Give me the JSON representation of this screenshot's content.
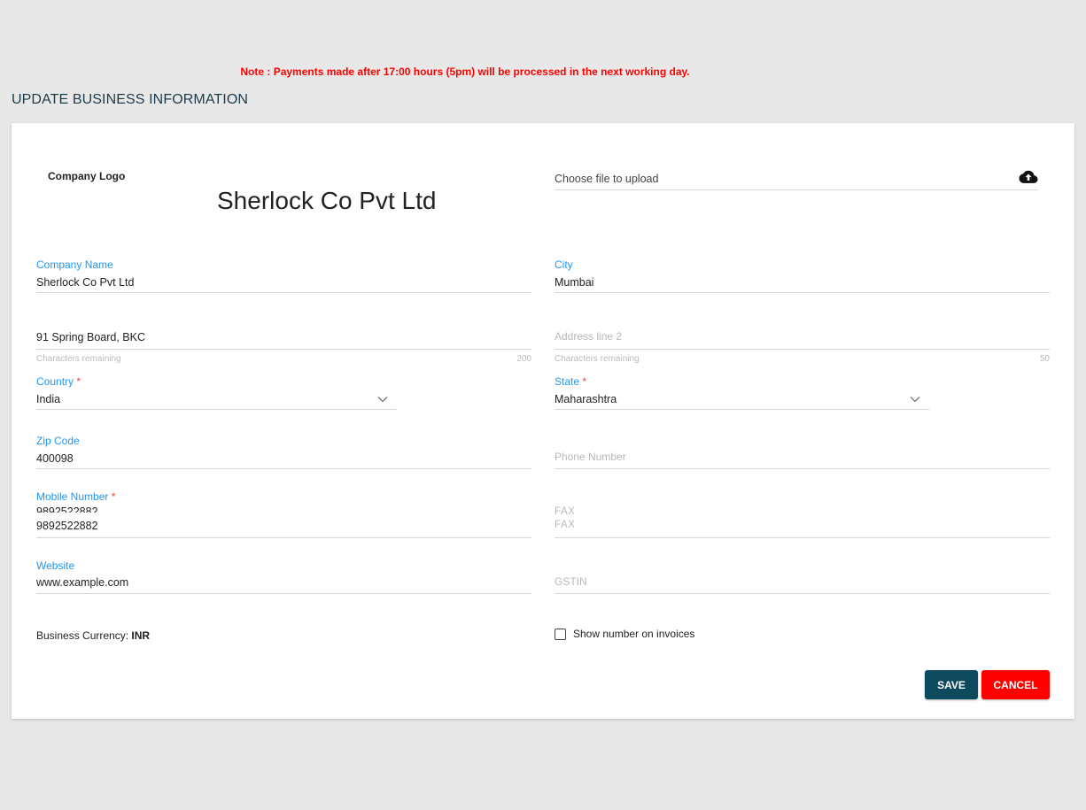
{
  "note": "Note : Payments made after 17:00 hours (5pm) will be processed in the next working day.",
  "page_title": "UPDATE BUSINESS INFORMATION",
  "logo": {
    "label": "Company Logo",
    "text": "Sherlock Co Pvt Ltd",
    "upload_placeholder": "Choose file to upload",
    "upload_icon": "cloud-upload-icon"
  },
  "fields": {
    "company_name": {
      "label": "Company Name",
      "value": "Sherlock Co Pvt Ltd"
    },
    "city": {
      "label": "City",
      "value": "Mumbai"
    },
    "address1": {
      "value": "91 Spring Board, BKC",
      "hint": "Characters remaining",
      "count": "200"
    },
    "address2": {
      "placeholder": "Address line 2",
      "hint": "Characters remaining",
      "count": "50"
    },
    "country": {
      "label": "Country",
      "required": "*",
      "value": "India"
    },
    "state": {
      "label": "State",
      "required": "*",
      "value": "Maharashtra"
    },
    "zip": {
      "label": "Zip Code",
      "value": "400098"
    },
    "phone": {
      "placeholder": "Phone Number"
    },
    "mobile": {
      "label": "Mobile Number",
      "required": "*",
      "value_overlay": "9892522882",
      "value": "9892522882"
    },
    "fax": {
      "label": "FAX",
      "placeholder": "FAX"
    },
    "website": {
      "label": "Website",
      "value": "www.example.com"
    },
    "gstin": {
      "placeholder": "GSTIN"
    }
  },
  "currency": {
    "label": "Business Currency:",
    "value": "INR"
  },
  "invoice_checkbox": {
    "label": "Show number on invoices",
    "checked": false
  },
  "buttons": {
    "save": "SAVE",
    "cancel": "CANCEL"
  },
  "colors": {
    "accent": "#2196f3",
    "save": "#0d4a5e",
    "cancel": "#ff0000",
    "note": "#ff0000"
  }
}
